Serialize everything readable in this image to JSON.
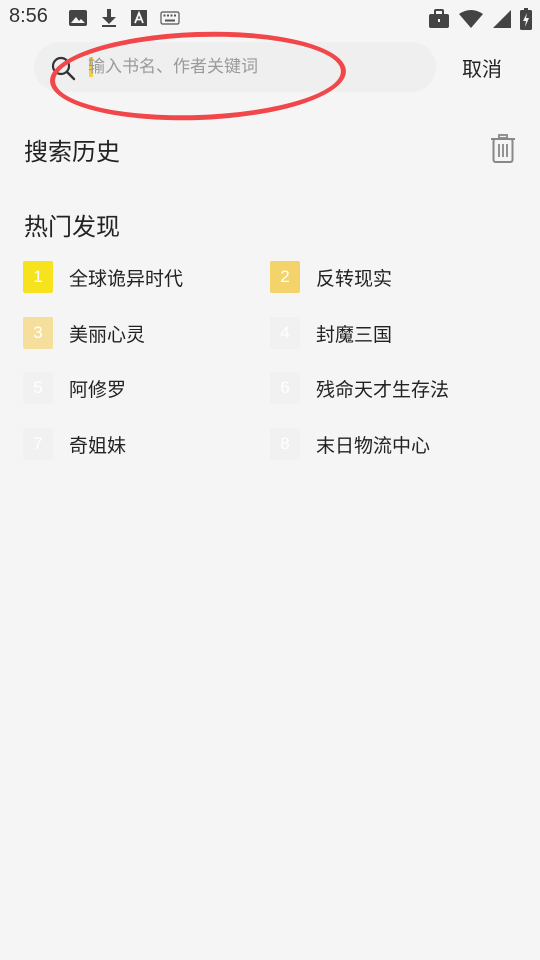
{
  "status_bar": {
    "time": "8:56",
    "left_icons": [
      "image-icon",
      "download-icon",
      "font-icon",
      "keyboard-icon"
    ],
    "right_icons": [
      "briefcase-icon",
      "wifi-icon",
      "signal-icon",
      "battery-icon"
    ]
  },
  "search": {
    "placeholder": "输入书名、作者关键词",
    "value": "",
    "cancel_label": "取消",
    "cursor_color": "#f5d23a"
  },
  "annotation": {
    "shape": "ellipse",
    "color": "#f1474a"
  },
  "history": {
    "title": "搜索历史",
    "clear_icon": "trash-icon"
  },
  "hot": {
    "title": "热门发现",
    "items": [
      {
        "rank": "1",
        "title": "全球诡异时代",
        "badge_color": "#f7e21e"
      },
      {
        "rank": "2",
        "title": "反转现实",
        "badge_color": "#f4d36b"
      },
      {
        "rank": "3",
        "title": "美丽心灵",
        "badge_color": "#f6df9c"
      },
      {
        "rank": "4",
        "title": "封魔三国",
        "badge_color": "#f1f1f1"
      },
      {
        "rank": "5",
        "title": "阿修罗",
        "badge_color": "#f1f1f1"
      },
      {
        "rank": "6",
        "title": "残命天才生存法",
        "badge_color": "#f1f1f1"
      },
      {
        "rank": "7",
        "title": "奇姐妹",
        "badge_color": "#f1f1f1"
      },
      {
        "rank": "8",
        "title": "末日物流中心",
        "badge_color": "#f1f1f1"
      }
    ]
  }
}
